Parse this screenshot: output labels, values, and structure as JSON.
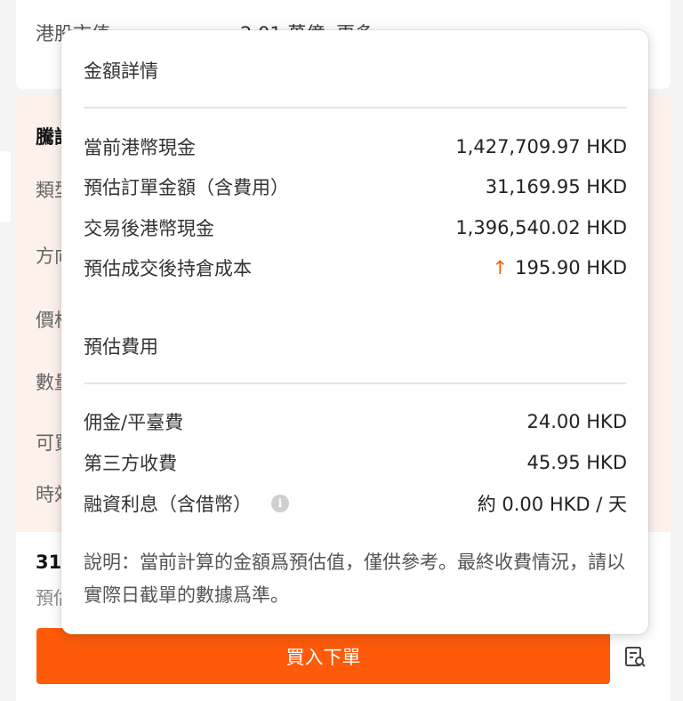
{
  "background": {
    "top_label": "港股市值",
    "top_value": "2.01 萬億",
    "top_more": "更多 ›",
    "order_title": "騰訊",
    "order_row_labels": [
      "類型",
      "方向",
      "價格",
      "數量",
      "可買",
      "時效"
    ],
    "amount": "31",
    "estimate_label": "預估"
  },
  "buy_button": {
    "label": "買入下單"
  },
  "popover": {
    "amount_details_title": "金額詳情",
    "amount_rows": [
      {
        "label": "當前港幣現金",
        "value": "1,427,709.97 HKD"
      },
      {
        "label": "預估訂單金額（含費用）",
        "value": "31,169.95 HKD"
      },
      {
        "label": "交易後港幣現金",
        "value": "1,396,540.02 HKD"
      },
      {
        "label": "預估成交後持倉成本",
        "value": "195.90 HKD",
        "indicator": "↑"
      }
    ],
    "fees_title": "預估費用",
    "fee_rows": [
      {
        "label": "佣金/平臺費",
        "value": "24.00 HKD"
      },
      {
        "label": "第三方收費",
        "value": "45.95 HKD"
      },
      {
        "label": "融資利息（含借幣）",
        "value": "約 0.00 HKD / 天",
        "info_icon": "i"
      }
    ],
    "note": "說明：當前計算的金額爲預估值，僅供參考。最終收費情況，請以實際日截單的數據爲準。"
  },
  "colors": {
    "accent": "#fe5a0a",
    "indicator_up": "#fe5a0a"
  },
  "icons": {
    "up_arrow": "arrow-up-icon",
    "info": "info-icon",
    "preview": "order-preview-icon"
  }
}
